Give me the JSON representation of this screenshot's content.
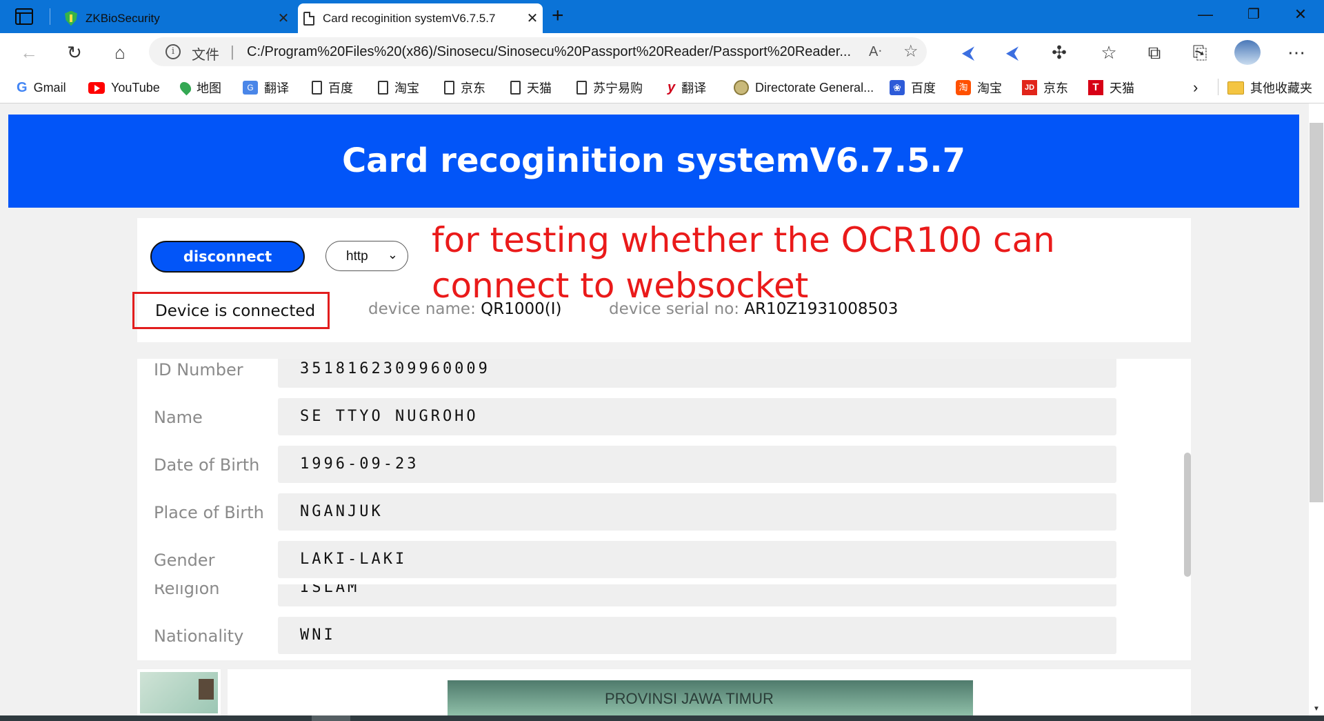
{
  "browser": {
    "tabs": [
      {
        "title": "ZKBioSecurity",
        "active": false
      },
      {
        "title": "Card recoginition systemV6.7.5.7",
        "active": true
      }
    ],
    "address": {
      "security_label": "文件",
      "url": "C:/Program%20Files%20(x86)/Sinosecu/Sinosecu%20Passport%20Reader/Passport%20Reader..."
    },
    "bookmarks": [
      {
        "label": "Gmail",
        "icon": "google-icon"
      },
      {
        "label": "YouTube",
        "icon": "youtube-icon"
      },
      {
        "label": "地图",
        "icon": "maps-pin-icon"
      },
      {
        "label": "翻译",
        "icon": "translate-icon"
      },
      {
        "label": "百度",
        "icon": "page-icon"
      },
      {
        "label": "淘宝",
        "icon": "page-icon"
      },
      {
        "label": "京东",
        "icon": "page-icon"
      },
      {
        "label": "天猫",
        "icon": "page-icon"
      },
      {
        "label": "苏宁易购",
        "icon": "page-icon"
      },
      {
        "label": "翻译",
        "icon": "youdao-icon"
      },
      {
        "label": "Directorate General...",
        "icon": "emblem-icon"
      },
      {
        "label": "百度",
        "icon": "baidu-paw-icon"
      },
      {
        "label": "淘宝",
        "icon": "taobao-icon"
      },
      {
        "label": "京东",
        "icon": "jd-icon"
      },
      {
        "label": "天猫",
        "icon": "tmall-icon"
      }
    ],
    "other_bookmarks": "其他收藏夹"
  },
  "page": {
    "banner_title": "Card recoginition systemV6.7.5.7",
    "disconnect_label": "disconnect",
    "protocol_value": "http",
    "annotation_text": "for testing whether the OCR100 can connect to websocket",
    "status_text": "Device is connected",
    "device_name_label": "device name:",
    "device_name": "QR1000(I)",
    "device_serial_label": "device serial no:",
    "device_serial": "AR10Z1931008503",
    "fields": [
      {
        "label": "ID Number",
        "value": "3518162309960009"
      },
      {
        "label": "Name",
        "value": "SE TTYO NUGROHO"
      },
      {
        "label": "Date of Birth",
        "value": "1996-09-23"
      },
      {
        "label": "Place of Birth",
        "value": "NGANJUK"
      },
      {
        "label": "Gender",
        "value": "LAKI-LAKI"
      },
      {
        "label": "Religion",
        "value": "ISLAM"
      },
      {
        "label": "Nationality",
        "value": "WNI"
      }
    ],
    "card_image_text": "PROVINSI JAWA TIMUR"
  },
  "colors": {
    "banner": "#0255f8",
    "annotation": "#ea1a1a",
    "tabbar": "#0b73d7"
  }
}
